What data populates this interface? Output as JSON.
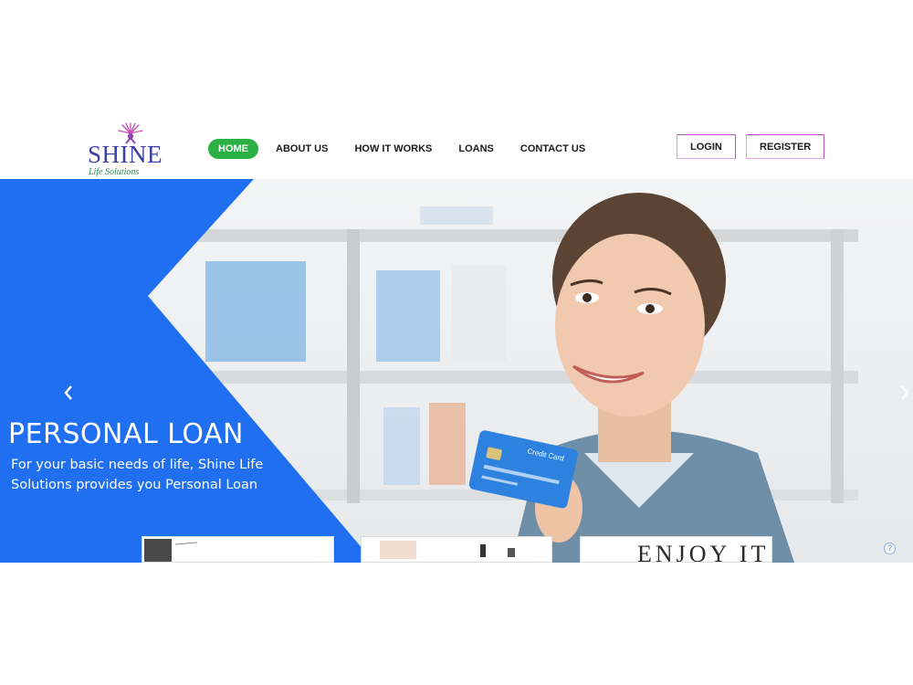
{
  "brand": {
    "name": "SHINE",
    "tagline": "Life Solutions",
    "colors": {
      "primary": "#3d3fa6",
      "tagline": "#2e8b57",
      "accent": "#b94dc8"
    }
  },
  "nav": {
    "items": [
      {
        "label": "HOME",
        "active": true
      },
      {
        "label": "ABOUT US",
        "active": false
      },
      {
        "label": "HOW IT WORKS",
        "active": false
      },
      {
        "label": "LOANS",
        "active": false
      },
      {
        "label": "CONTACT US",
        "active": false
      }
    ],
    "active_color": "#2bb043"
  },
  "auth": {
    "login_label": "LOGIN",
    "register_label": "REGISTER"
  },
  "hero": {
    "title": "PERSONAL LOAN",
    "description": "For your basic needs of life, Shine Life Solutions provides you Personal Loan",
    "panel_color": "#1f6ff0",
    "prev_icon": "chevron-left-icon",
    "next_icon": "chevron-right-icon",
    "card_text": "Credit Card"
  },
  "thumbnails": [
    {
      "text": ""
    },
    {
      "text": ""
    },
    {
      "text": "ENJOY IT"
    }
  ],
  "help_icon": "help-icon"
}
